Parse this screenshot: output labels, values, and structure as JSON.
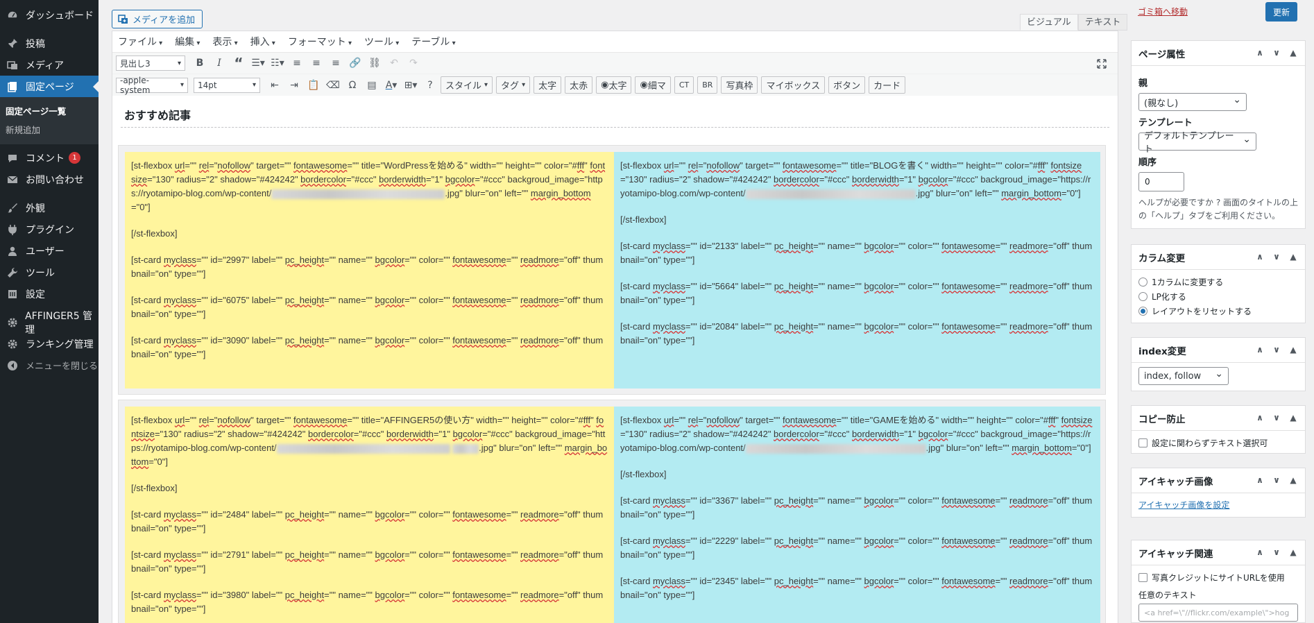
{
  "sidebar": {
    "items": [
      {
        "label": "ダッシュボード",
        "icon": "dashboard-icon"
      },
      {
        "label": "投稿",
        "icon": "pin-icon"
      },
      {
        "label": "メディア",
        "icon": "media-icon"
      },
      {
        "label": "固定ページ",
        "icon": "pages-icon"
      },
      {
        "label": "コメント",
        "icon": "comment-icon",
        "badge": "1"
      },
      {
        "label": "お問い合わせ",
        "icon": "mail-icon"
      },
      {
        "label": "外観",
        "icon": "brush-icon"
      },
      {
        "label": "プラグイン",
        "icon": "plugin-icon"
      },
      {
        "label": "ユーザー",
        "icon": "user-icon"
      },
      {
        "label": "ツール",
        "icon": "wrench-icon"
      },
      {
        "label": "設定",
        "icon": "settings-icon"
      },
      {
        "label": "AFFINGER5 管理",
        "icon": "gear-icon"
      },
      {
        "label": "ランキング管理",
        "icon": "gear-icon"
      },
      {
        "label": "メニューを閉じる",
        "icon": "collapse-icon"
      }
    ],
    "sub_items": [
      "固定ページ一覧",
      "新規追加"
    ]
  },
  "editor": {
    "add_media": "メディアを追加",
    "tab_visual": "ビジュアル",
    "tab_text": "テキスト",
    "menubar": [
      "ファイル",
      "編集",
      "表示",
      "挿入",
      "フォーマット",
      "ツール",
      "テーブル"
    ],
    "format_select": "見出し3",
    "font_family": "-apple-system",
    "font_size": "14pt",
    "buttons": [
      "スタイル",
      "タグ",
      "太字",
      "太赤",
      "太字",
      "細マ",
      "CT",
      "BR",
      "写真枠",
      "マイボックス",
      "ボタン",
      "カード"
    ],
    "heading": "おすすめ記事",
    "blocks": [
      {
        "left": {
          "flex_title": "WordPressを始める",
          "bg_suffix": ".jpg",
          "card_ids": [
            "2997",
            "6075",
            "3090"
          ]
        },
        "right": {
          "flex_title": "BLOGを書く",
          "bg_suffix": ".jpg",
          "card_ids": [
            "2133",
            "5664",
            "2084"
          ]
        }
      },
      {
        "left": {
          "flex_title": "AFFINGER5の使い方",
          "bg_suffix": ".jpg",
          "card_ids": [
            "2484",
            "2791",
            "3980"
          ]
        },
        "right": {
          "flex_title": "GAMEを始める",
          "bg_suffix": ".jpg",
          "card_ids": [
            "3367",
            "2229",
            "2345"
          ]
        }
      }
    ],
    "shortcode_text": {
      "bg_url_prefix": "backgroud_image=\"https://ryotamipo-blog.com/wp-content/",
      "close_tag": "[/st-flexbox]"
    }
  },
  "right_panel": {
    "trash_link": "ゴミ箱へ移動",
    "update_button": "更新",
    "page_attr": {
      "title": "ページ属性",
      "parent_label": "親",
      "parent_value": "(親なし)",
      "template_label": "テンプレート",
      "template_value": "デフォルトテンプレート",
      "order_label": "順序",
      "order_value": "0",
      "help": "ヘルプが必要ですか ? 画面のタイトルの上の「ヘルプ」タブをご利用ください。"
    },
    "column_change": {
      "title": "カラム変更",
      "options": [
        "1カラムに変更する",
        "LP化する",
        "レイアウトをリセットする"
      ],
      "selected": 2
    },
    "index_change": {
      "title": "index変更",
      "value": "index, follow"
    },
    "copy_protect": {
      "title": "コピー防止",
      "checkbox": "設定に関わらずテキスト選択可"
    },
    "eyecatch": {
      "title": "アイキャッチ画像",
      "link": "アイキャッチ画像を設定"
    },
    "eyecatch_related": {
      "title": "アイキャッチ関連",
      "checkbox": "写真クレジットにサイトURLを使用",
      "text_label": "任意のテキスト",
      "placeholder": "<a href=\\\"//flickr.com/example\\\">hog"
    }
  },
  "colors": {
    "sidebar_bg": "#1d2327",
    "accent": "#2271b1",
    "yellow_col": "#fff59d",
    "blue_col": "#b3ebf2",
    "badge": "#d63638"
  }
}
